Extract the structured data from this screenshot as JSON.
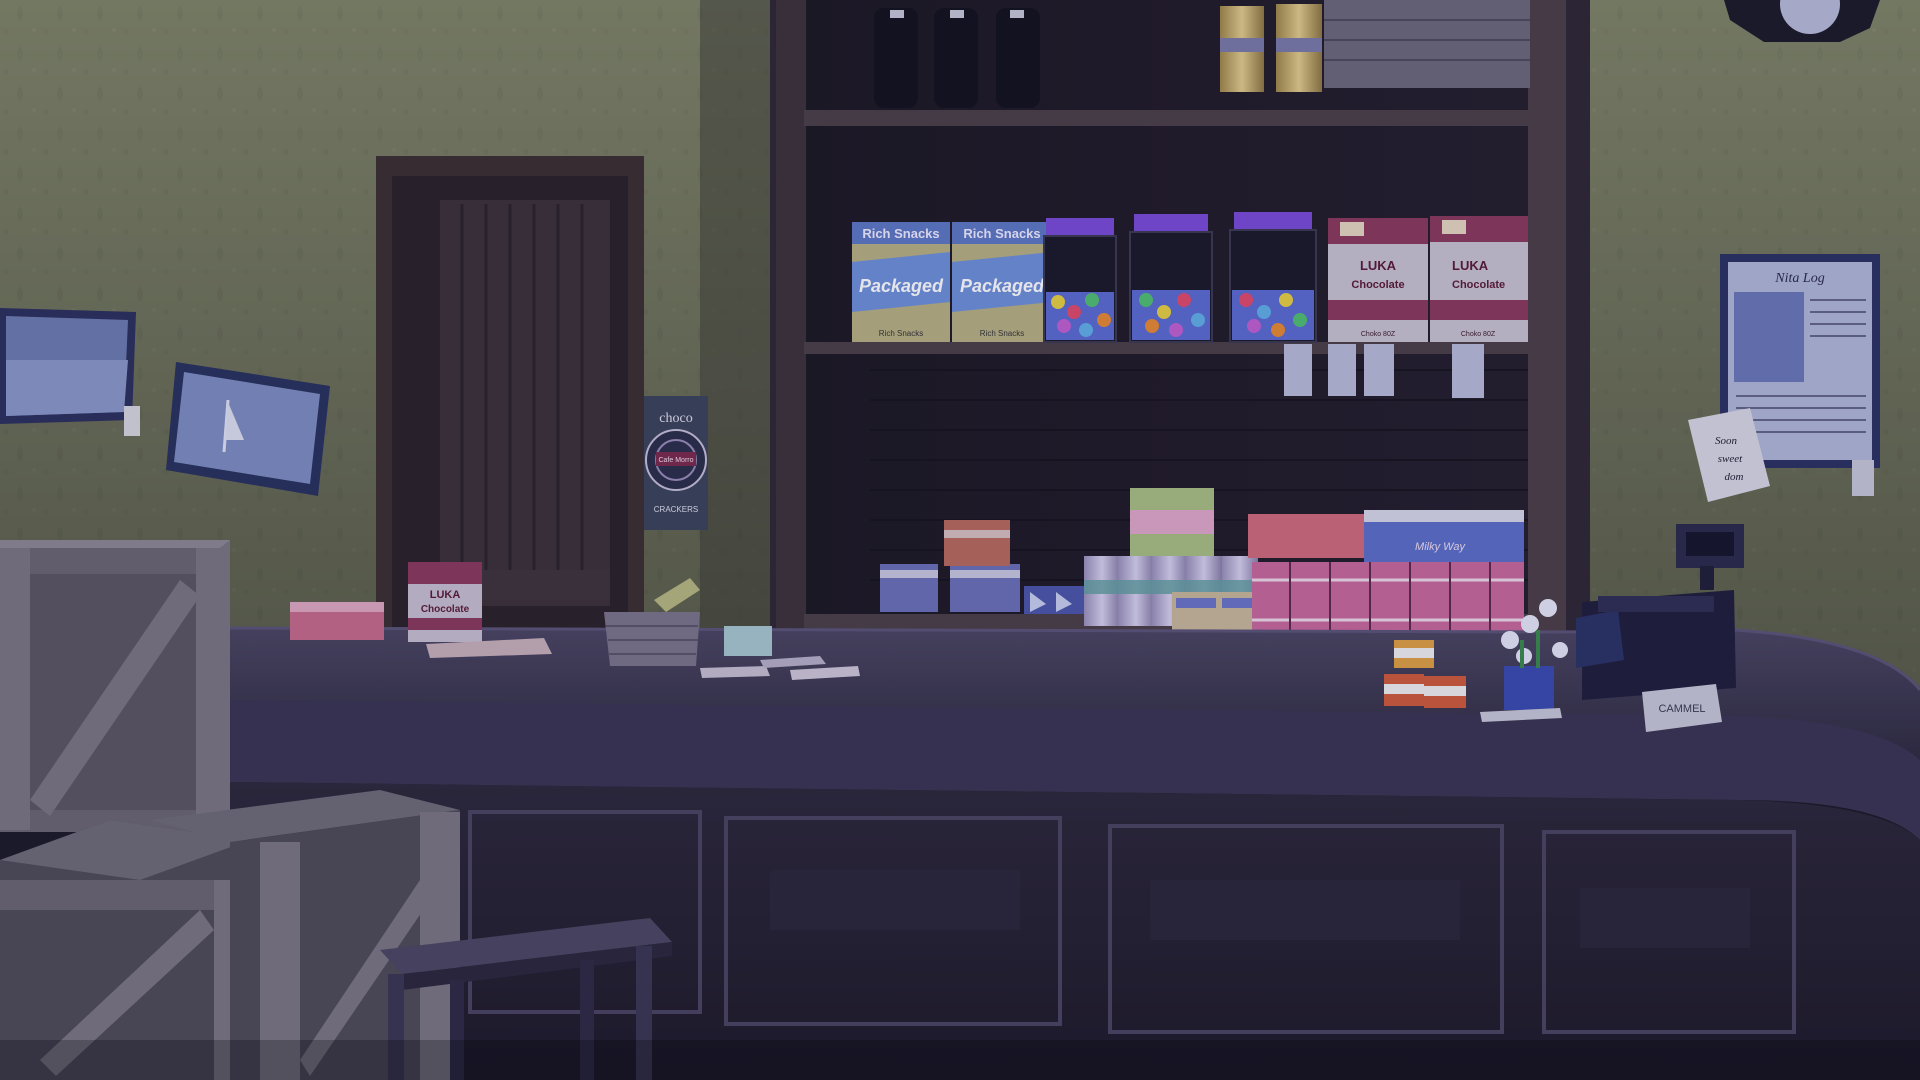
{
  "scene": {
    "name": "General store counter at night"
  },
  "items": {
    "rich_snacks_brand": "Rich Snacks",
    "rich_snacks_word": "Packaged",
    "rich_snacks_small": "Rich Snacks",
    "luka_brand": "LUKA",
    "luka_product": "Chocolate",
    "luka_small": "Choko 80Z",
    "counter_luka_brand": "LUKA",
    "counter_luka_product": "Chocolate",
    "choco_top": "choco",
    "choco_center": "Cafe Morro",
    "choco_bottom": "CRACKERS",
    "milky_can": "Milky Way",
    "poster_title": "Nita Log",
    "note_line1": "Soon",
    "note_line2": "sweet",
    "note_line3": "dom",
    "counter_sign": "CAMMEL"
  },
  "colors": {
    "wall": "#8a8e6c",
    "wood_dark": "#2a2434",
    "counter_top": "#3f3a54",
    "crate": "#5a5660",
    "accent_purple": "#7a4ad8"
  }
}
